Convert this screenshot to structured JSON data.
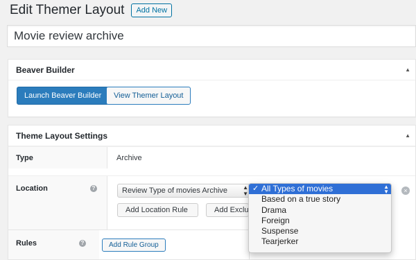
{
  "header": {
    "title": "Edit Themer Layout",
    "add_new_label": "Add New"
  },
  "title_field": {
    "value": "Movie review archive"
  },
  "beaver_builder": {
    "heading": "Beaver Builder",
    "launch_label": "Launch Beaver Builder",
    "view_label": "View Themer Layout"
  },
  "settings": {
    "heading": "Theme Layout Settings",
    "type_label": "Type",
    "type_value": "Archive",
    "location_label": "Location",
    "help_glyph": "?",
    "location_select_value": "Review Type of movies Archive",
    "add_location_rule_label": "Add Location Rule",
    "add_exclusion_label": "Add Exclusion Rule",
    "remove_glyph": "×"
  },
  "rules": {
    "label": "Rules",
    "help_glyph": "?",
    "add_group_label": "Add Rule Group"
  },
  "dropdown": {
    "check_glyph": "✓",
    "options": [
      {
        "label": "All Types of movies",
        "selected": true
      },
      {
        "label": "Based on a true story"
      },
      {
        "label": "Drama"
      },
      {
        "label": "Foreign"
      },
      {
        "label": "Suspense"
      },
      {
        "label": "Tearjerker"
      }
    ]
  },
  "icons": {
    "collapse": "▲",
    "select_up": "▲",
    "select_down": "▼"
  },
  "colors": {
    "accent": "#2b7cbc",
    "selected_option": "#2f6fd6"
  }
}
